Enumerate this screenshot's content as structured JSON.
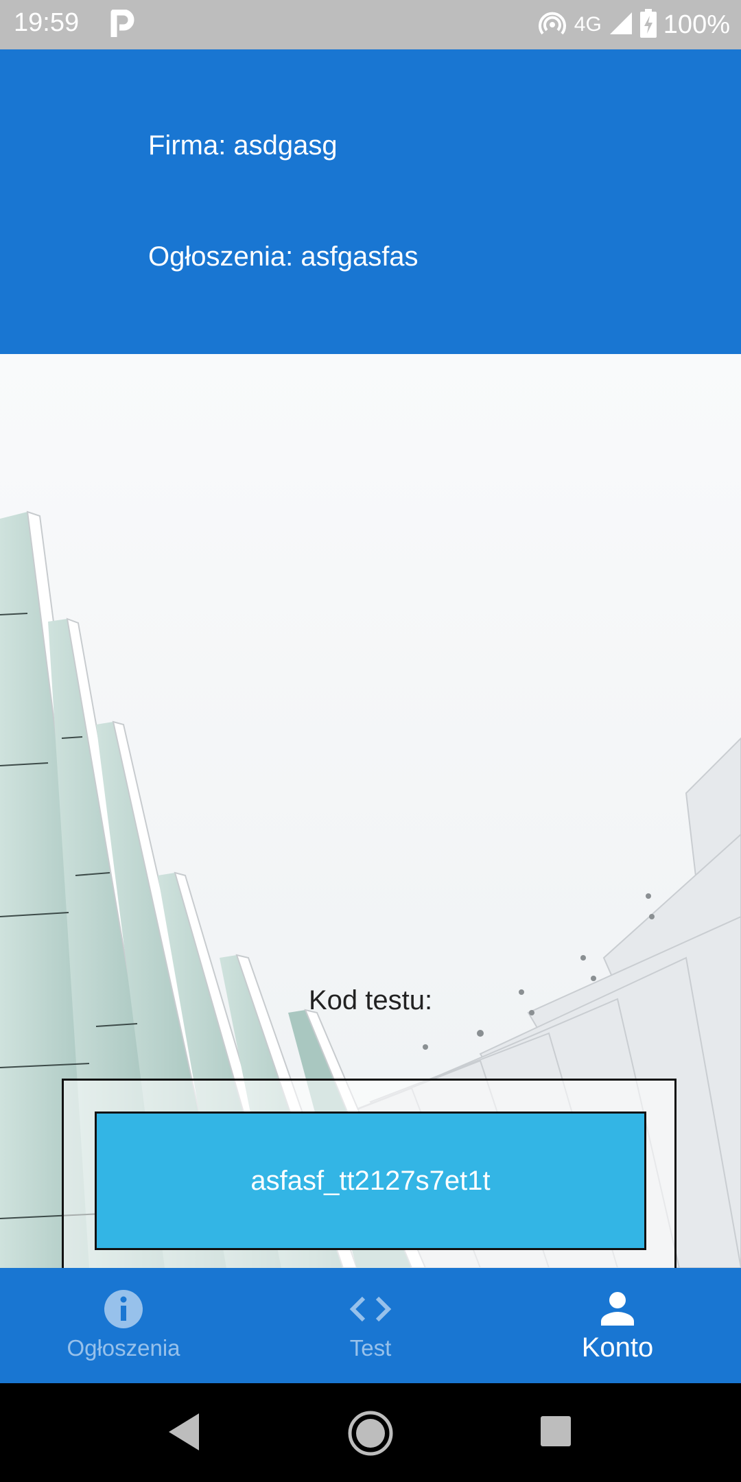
{
  "status_bar": {
    "time": "19:59",
    "network": "4G",
    "battery": "100%",
    "icons": [
      "parking-app-icon",
      "hotspot-icon",
      "signal-icon",
      "battery-charging-icon"
    ]
  },
  "header": {
    "firma_line": "Firma: asdgasg",
    "ogloszenia_line": "Ogłoszenia: asfgasfas",
    "color": "#1976d2"
  },
  "main": {
    "code_label": "Kod testu:",
    "code_value": "asfasf_tt2127s7et1t",
    "code_box_color": "#33b5e5"
  },
  "bottom_nav": {
    "items": [
      {
        "label": "Ogłoszenia",
        "icon": "info-icon",
        "active": false
      },
      {
        "label": "Test",
        "icon": "code-icon",
        "active": false
      },
      {
        "label": "Konto",
        "icon": "person-icon",
        "active": true
      }
    ]
  },
  "system_nav": {
    "icons": [
      "back-icon",
      "home-icon",
      "recents-icon"
    ]
  }
}
